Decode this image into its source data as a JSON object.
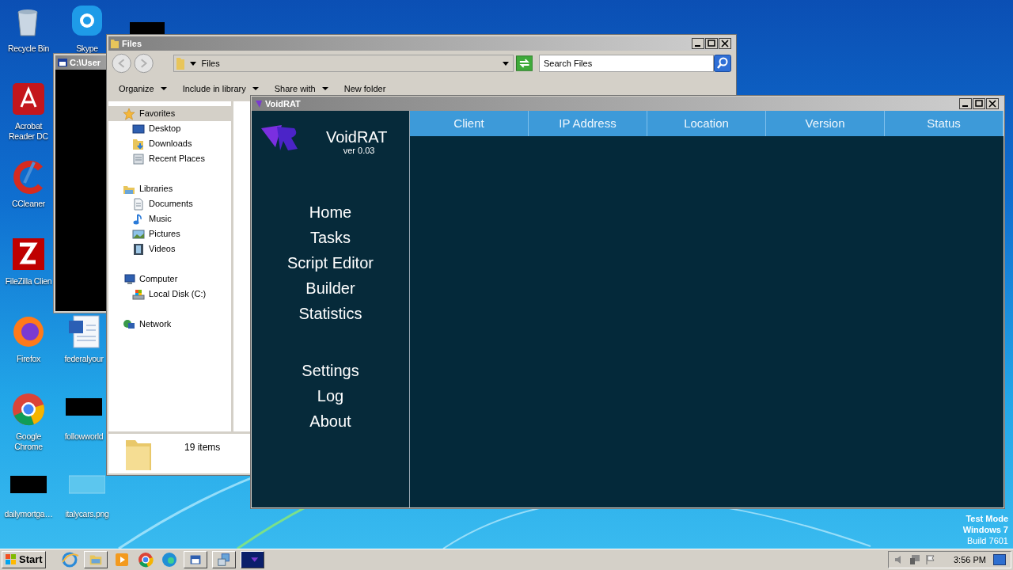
{
  "desktop_icons": [
    {
      "label": "Recycle Bin",
      "kind": "recycle"
    },
    {
      "label": "Skype",
      "kind": "skype"
    },
    {
      "label": "Acrobat Reader DC",
      "kind": "acrobat"
    },
    {
      "label": "CCleaner",
      "kind": "ccleaner"
    },
    {
      "label": "FileZilla Clien",
      "kind": "filezilla"
    },
    {
      "label": "Firefox",
      "kind": "firefox"
    },
    {
      "label": "federalyour",
      "kind": "word"
    },
    {
      "label": "Google Chrome",
      "kind": "chrome"
    },
    {
      "label": "followworld",
      "kind": "redacted"
    },
    {
      "label": "dailymortga…",
      "kind": "redacted"
    },
    {
      "label": "italycars.png",
      "kind": "image"
    }
  ],
  "console_window": {
    "title": "C:\\User"
  },
  "explorer": {
    "title": "Files",
    "address": "Files",
    "search": {
      "placeholder": "Search Files"
    },
    "toolbar": [
      "Organize",
      "Include in library",
      "Share with",
      "New folder"
    ],
    "nav": [
      {
        "label": "Favorites",
        "kind": "favorites",
        "selected": true,
        "children": [
          {
            "label": "Desktop",
            "kind": "desktop",
            "selected": false
          },
          {
            "label": "Downloads",
            "kind": "downloads",
            "selected": false
          },
          {
            "label": "Recent Places",
            "kind": "recent",
            "selected": false
          }
        ]
      },
      {
        "label": "Libraries",
        "kind": "libraries",
        "selected": false,
        "children": [
          {
            "label": "Documents",
            "kind": "documents",
            "selected": false
          },
          {
            "label": "Music",
            "kind": "music",
            "selected": false
          },
          {
            "label": "Pictures",
            "kind": "pictures",
            "selected": false
          },
          {
            "label": "Videos",
            "kind": "videos",
            "selected": false
          }
        ]
      },
      {
        "label": "Computer",
        "kind": "computer",
        "selected": false,
        "children": [
          {
            "label": "Local Disk (C:)",
            "kind": "disk",
            "selected": false
          }
        ]
      },
      {
        "label": "Network",
        "kind": "network",
        "selected": false
      }
    ],
    "status": "19 items"
  },
  "voidrat": {
    "title": "VoidRAT",
    "app_name": "VoidRAT",
    "version": "ver 0.03",
    "menu": [
      "Home",
      "Tasks",
      "Script Editor",
      "Builder",
      "Statistics"
    ],
    "menu_bottom": [
      "Settings",
      "Log",
      "About"
    ],
    "columns": [
      "Client",
      "IP Address",
      "Location",
      "Version",
      "Status"
    ]
  },
  "taskbar": {
    "start": "Start",
    "items": [
      {
        "kind": "ie"
      },
      {
        "kind": "folder"
      },
      {
        "kind": "media"
      },
      {
        "kind": "chrome"
      },
      {
        "kind": "edge"
      },
      {
        "kind": "app"
      },
      {
        "kind": "installer"
      },
      {
        "kind": "voidrat"
      }
    ],
    "clock": "3:56 PM"
  },
  "os_notice": [
    "Test Mode",
    "Windows 7",
    "Build 7601"
  ]
}
